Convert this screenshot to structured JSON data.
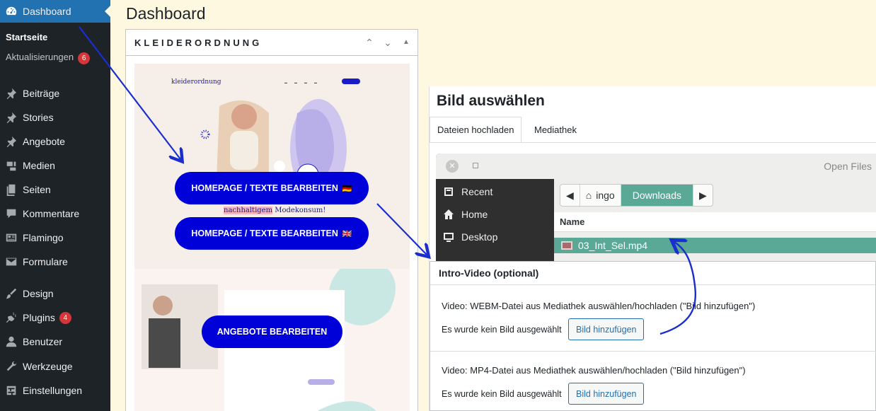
{
  "sidebar": {
    "dashboard": "Dashboard",
    "startseite": "Startseite",
    "aktualisierungen": "Aktualisierungen",
    "updates_count": "6",
    "items": [
      {
        "label": "Beiträge",
        "icon": "pin-icon"
      },
      {
        "label": "Stories",
        "icon": "pin-icon"
      },
      {
        "label": "Angebote",
        "icon": "pin-icon"
      },
      {
        "label": "Medien",
        "icon": "media-icon"
      },
      {
        "label": "Seiten",
        "icon": "pages-icon"
      },
      {
        "label": "Kommentare",
        "icon": "comment-icon"
      },
      {
        "label": "Flamingo",
        "icon": "address-card-icon"
      },
      {
        "label": "Formulare",
        "icon": "mail-icon"
      },
      {
        "label": "Design",
        "icon": "brush-icon"
      },
      {
        "label": "Plugins",
        "icon": "plug-icon"
      },
      {
        "label": "Benutzer",
        "icon": "user-icon"
      },
      {
        "label": "Werkzeuge",
        "icon": "wrench-icon"
      },
      {
        "label": "Einstellungen",
        "icon": "settings-icon"
      }
    ],
    "plugins_count": "4"
  },
  "page": {
    "title": "Dashboard"
  },
  "widget": {
    "title": "KLEIDERORDNUNG",
    "brand": "kleiderordnung",
    "btn_homepage_de": "HOMEPAGE / TEXTE BEARBEITEN",
    "btn_homepage_en": "HOMEPAGE / TEXTE BEARBEITEN",
    "flag_de": "🇩🇪",
    "flag_en": "🇬🇧",
    "tagline_hl": "nachhaltigem",
    "tagline_rest": " Modekonsum!",
    "btn_angebote": "ANGEBOTE BEARBEITEN"
  },
  "dialog": {
    "title": "Bild auswählen",
    "tab_upload": "Dateien hochladen",
    "tab_library": "Mediathek"
  },
  "filechooser": {
    "title": "Open Files",
    "places": [
      "Recent",
      "Home",
      "Desktop"
    ],
    "path": [
      "ingo",
      "Downloads"
    ],
    "column": "Name",
    "selected_file": "03_Int_Sel.mp4"
  },
  "metabox": {
    "title": "Intro-Video (optional)",
    "webm_label": "Video: WEBM-Datei aus Mediathek auswählen/hochladen (\"Bild hinzufügen\")",
    "mp4_label": "Video: MP4-Datei aus Mediathek auswählen/hochladen (\"Bild hinzufügen\")",
    "none_text": "Es wurde kein Bild ausgewählt",
    "add_button": "Bild hinzufügen"
  },
  "colors": {
    "sidebar_bg": "#1d2327",
    "accent": "#2271b1",
    "cta_blue": "#0000d8",
    "selection_green": "#5aa997",
    "badge_red": "#d63638",
    "page_bg": "#fff8e1"
  }
}
